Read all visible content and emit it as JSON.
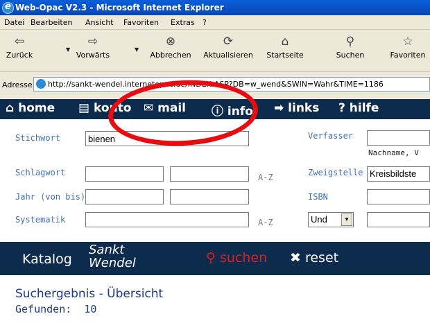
{
  "window": {
    "title": "Web-Opac V2.3 - Microsoft Internet Explorer"
  },
  "menu": [
    "Datei",
    "Bearbeiten",
    "Ansicht",
    "Favoriten",
    "Extras",
    "?"
  ],
  "toolbar": {
    "back": "Zurück",
    "forward": "Vorwärts",
    "stop": "Abbrechen",
    "refresh": "Aktualisieren",
    "home": "Startseite",
    "search": "Suchen",
    "favorites": "Favoriten"
  },
  "address": {
    "label": "Adresse",
    "url": "http://sankt-wendel.internetopac.de/INDEX.ASP?DB=w_wend&SWIN=Wahr&TIME=1186"
  },
  "nav": {
    "home": "home",
    "konto": "konto",
    "mail": "mail",
    "info": "info",
    "links": "links",
    "hilfe": "? hilfe"
  },
  "form": {
    "stichwort_label": "Stichwort",
    "stichwort_value": "bienen",
    "verfasser_label": "Verfasser",
    "verfasser_hint": "Nachname, V",
    "schlagwort_label": "Schlagwort",
    "zweigstelle_label": "Zweigstelle",
    "zweigstelle_value": "Kreisbildste",
    "jahr_label": "Jahr (von bis)",
    "isbn_label": "ISBN",
    "systematik_label": "Systematik",
    "und_value": "Und",
    "az_label": "A-Z"
  },
  "footer": {
    "katalog": "Katalog",
    "location_line1": "Sankt",
    "location_line2": "Wendel",
    "suchen": "suchen",
    "reset": "reset"
  },
  "results": {
    "title": "Suchergebnis - Übersicht",
    "found_label": "Gefunden:",
    "found_count": "10"
  },
  "colors": {
    "titlebar": "#0746b8",
    "navbar": "#0d2b4d",
    "label_blue": "#4070b8",
    "suchen_red": "#e31c1c",
    "highlight_red": "#e80c10"
  }
}
